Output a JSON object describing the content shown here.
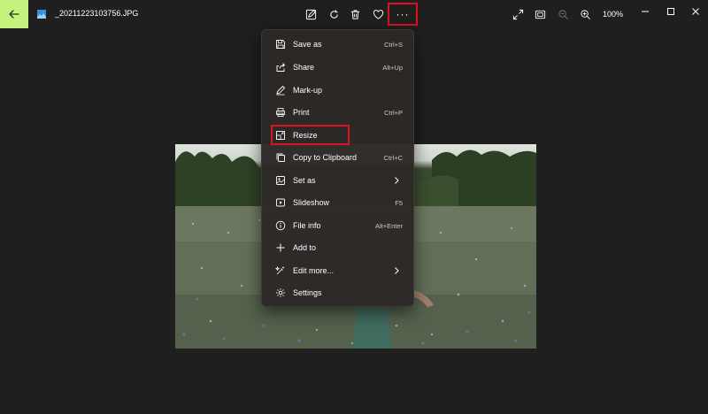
{
  "titlebar": {
    "file_name": "_20211223103756.JPG",
    "zoom": "100%",
    "back_icon": "arrow-left-icon",
    "accent_color": "#c5f27c",
    "highlight_color": "#e01020"
  },
  "toolbar": {
    "buttons": [
      "edit-image-icon",
      "rotate-icon",
      "delete-icon",
      "favorite-heart-icon",
      "more-options-icon"
    ],
    "more_label": "···",
    "right_buttons": [
      "expand-icon",
      "fit-window-icon",
      "zoom-out-icon",
      "zoom-in-icon"
    ]
  },
  "window_controls": [
    "minimize-icon",
    "maximize-icon",
    "close-icon"
  ],
  "menu": {
    "items": [
      {
        "label": "Save as",
        "shortcut": "Ctrl+S",
        "icon": "save-icon"
      },
      {
        "label": "Share",
        "shortcut": "Alt+Up",
        "icon": "share-icon"
      },
      {
        "label": "Mark-up",
        "shortcut": "",
        "icon": "pen-icon"
      },
      {
        "label": "Print",
        "shortcut": "Ctrl+P",
        "icon": "printer-icon"
      },
      {
        "label": "Resize",
        "shortcut": "",
        "icon": "resize-icon"
      },
      {
        "label": "Copy to Clipboard",
        "shortcut": "Ctrl+C",
        "icon": "copy-icon"
      },
      {
        "label": "Set as",
        "shortcut": "",
        "icon": "set-as-icon",
        "submenu": true
      },
      {
        "label": "Slideshow",
        "shortcut": "F5",
        "icon": "slideshow-icon"
      },
      {
        "label": "File info",
        "shortcut": "Alt+Enter",
        "icon": "info-icon"
      },
      {
        "label": "Add to",
        "shortcut": "",
        "icon": "plus-icon"
      },
      {
        "label": "Edit more...",
        "shortcut": "",
        "icon": "edit-more-icon",
        "submenu": true
      },
      {
        "label": "Settings",
        "shortcut": "",
        "icon": "settings-gear-icon"
      }
    ]
  }
}
